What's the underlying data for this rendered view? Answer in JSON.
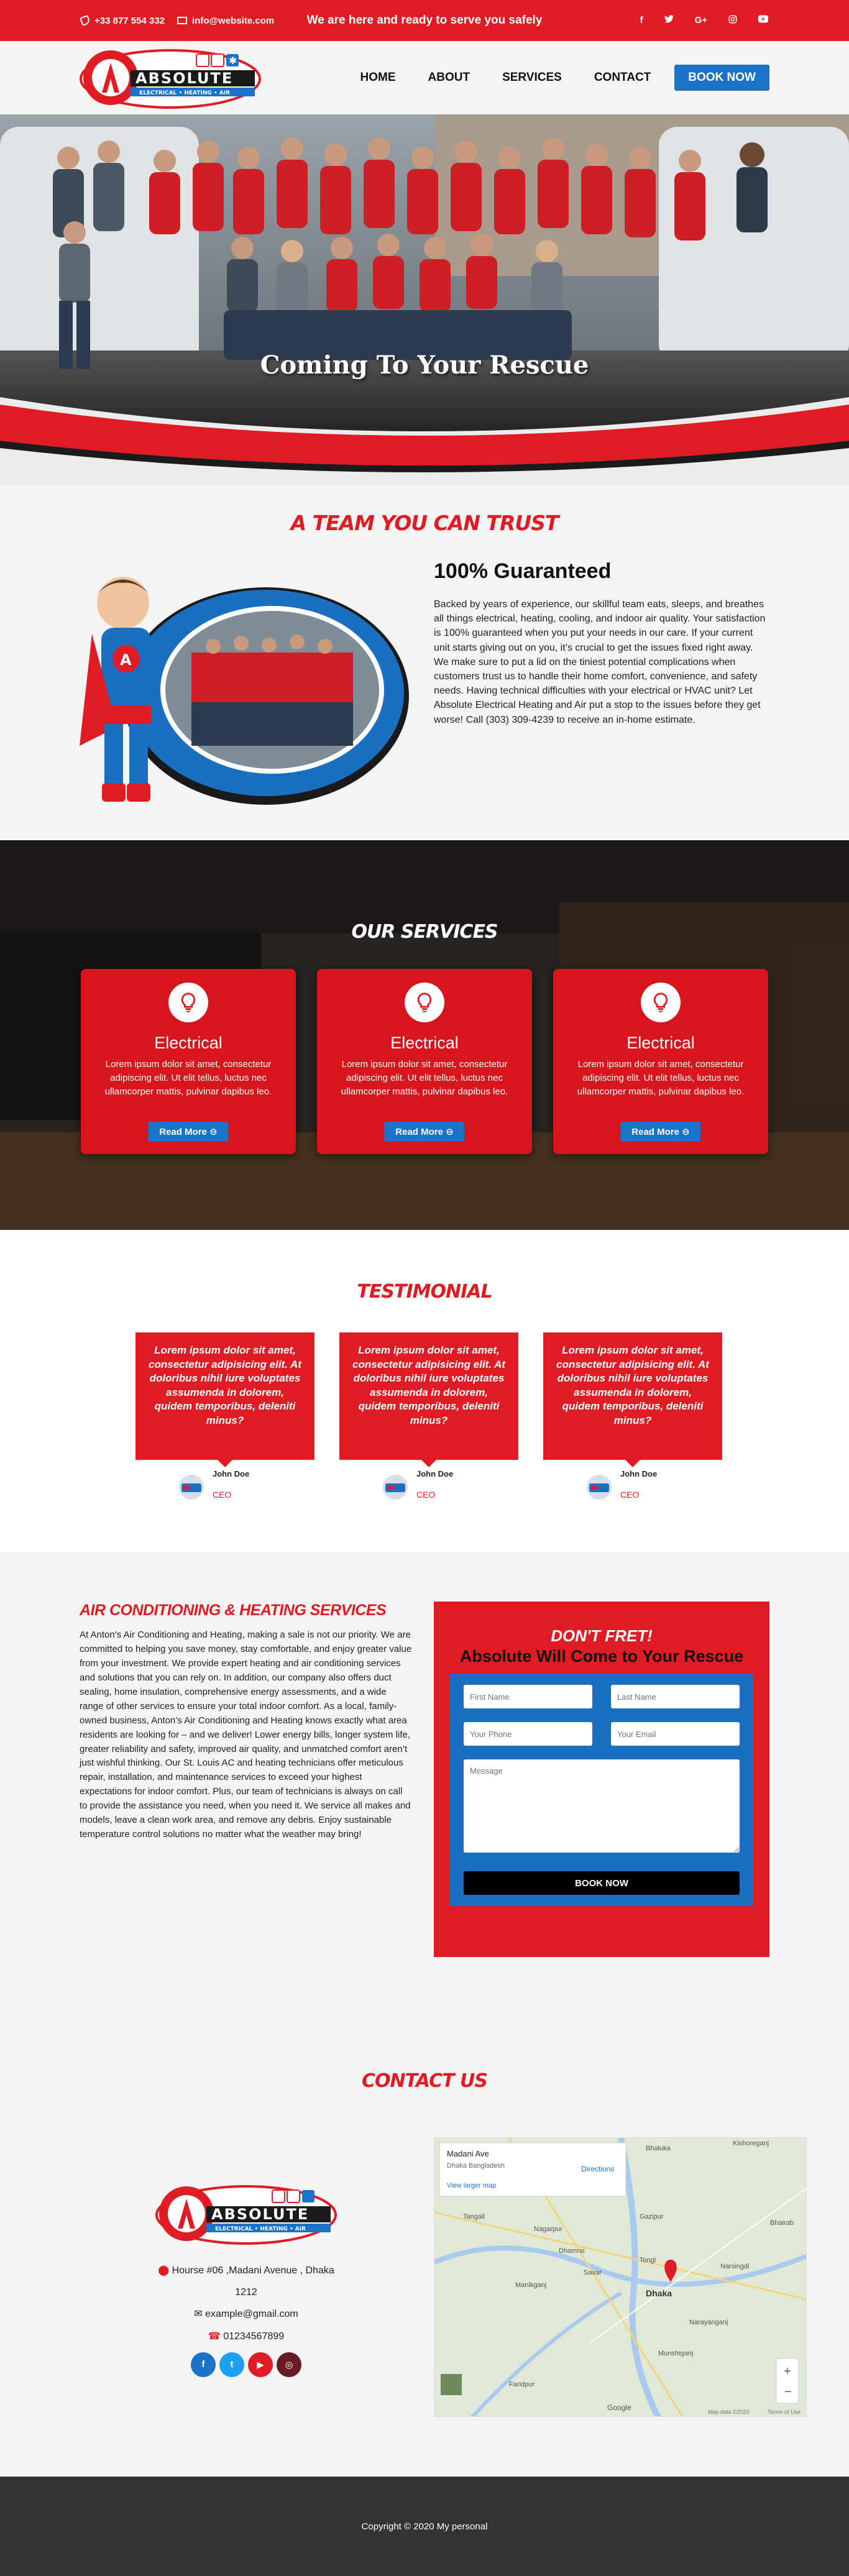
{
  "topbar": {
    "phone": "+33 877 554 332",
    "email": "info@website.com",
    "tagline": "We are here and ready to serve you safely",
    "socials": [
      "f",
      "t",
      "G+",
      "ig",
      "yt"
    ]
  },
  "header": {
    "logo_text": "ABSOLUTE",
    "logo_sub": "ELECTRICAL • HEATING • AIR",
    "nav": [
      "HOME",
      "ABOUT",
      "SERVICES",
      "CONTACT"
    ],
    "book_label": "BOOK NOW"
  },
  "hero": {
    "title": "Coming To Your Rescue"
  },
  "trust": {
    "section_title": "A TEAM YOU CAN TRUST",
    "heading": "100% Guaranteed",
    "body": "Backed by years of experience, our skillful team eats, sleeps, and breathes all things electrical, heating, cooling, and indoor air quality. Your satisfaction is 100% guaranteed when you put your needs in our care. If your current unit starts giving out on you, it’s crucial to get the issues fixed right away. We make sure to put a lid on the tiniest potential complications when customers trust us to handle their home comfort, convenience, and safety needs. Having technical difficulties with your electrical or HVAC unit? Let Absolute Electrical Heating and Air put a stop to the issues before they get worse! Call (303) 309-4239 to receive an in-home estimate."
  },
  "services": {
    "section_title": "OUR SERVICES",
    "cards": [
      {
        "title": "Electrical",
        "body": "Lorem ipsum dolor sit amet, consectetur adipiscing elit. Ut elit tellus, luctus nec ullamcorper mattis, pulvinar dapibus leo.",
        "button": "Read More"
      },
      {
        "title": "Electrical",
        "body": "Lorem ipsum dolor sit amet, consectetur adipiscing elit. Ut elit tellus, luctus nec ullamcorper mattis, pulvinar dapibus leo.",
        "button": "Read More"
      },
      {
        "title": "Electrical",
        "body": "Lorem ipsum dolor sit amet, consectetur adipiscing elit. Ut elit tellus, luctus nec ullamcorper mattis, pulvinar dapibus leo.",
        "button": "Read More"
      }
    ]
  },
  "testimonial": {
    "section_title": "TESTIMONIAL",
    "items": [
      {
        "quote": "Lorem ipsum dolor sit amet, consectetur adipisicing elit. At doloribus nihil iure voluptates assumenda in dolorem, quidem temporibus, deleniti minus?",
        "name": "John Doe",
        "role": "CEO"
      },
      {
        "quote": "Lorem ipsum dolor sit amet, consectetur adipisicing elit. At doloribus nihil iure voluptates assumenda in dolorem, quidem temporibus, deleniti minus?",
        "name": "John Doe",
        "role": "CEO"
      },
      {
        "quote": "Lorem ipsum dolor sit amet, consectetur adipisicing elit. At doloribus nihil iure voluptates assumenda in dolorem, quidem temporibus, deleniti minus?",
        "name": "John Doe",
        "role": "CEO"
      }
    ]
  },
  "ac": {
    "title": "AIR CONDITIONING & HEATING SERVICES",
    "body": "At Anton’s Air Conditioning and Heating, making a sale is not our priority. We are committed to helping you save money, stay comfortable, and enjoy greater value from your investment. We provide expert heating and air conditioning services and solutions that you can rely on. In addition, our company also offers duct sealing, home insulation, comprehensive energy assessments, and a wide range of other services to ensure your total indoor comfort. As a local, family-owned business, Anton’s Air Conditioning and Heating knows exactly what area residents are looking for – and we deliver! Lower energy bills, longer system life, greater reliability and safety, improved air quality, and unmatched comfort aren’t just wishful thinking. Our St. Louis AC and heating technicians offer meticulous repair, installation, and maintenance services to exceed your highest expectations for indoor comfort. Plus, our team of technicians is always on call to provide the assistance you need, when you need it. We service all makes and models, leave a clean work area, and remove any debris. Enjoy sustainable temperature control solutions no matter what the weather may bring!"
  },
  "form": {
    "kicker": "DON'T FRET!",
    "heading": "Absolute Will Come to Your Rescue",
    "first_name": "First Name",
    "last_name": "Last Name",
    "phone": "Your Phone",
    "email": "Your Email",
    "message": "Message",
    "submit": "BOOK NOW"
  },
  "contact": {
    "section_title": "CONTACT US",
    "address": "Hourse #06 ,Madani Avenue , Dhaka 1212",
    "email": "example@gmail.com",
    "phone": "01234567899",
    "map": {
      "place": "Madani Ave",
      "city": "Dhaka Bangladesh",
      "link": "View larger map",
      "directions": "Directions",
      "labels": [
        "Bhaluka",
        "Kishoreganj",
        "Tangail",
        "Gazipur",
        "Dhaka",
        "Narsingdi",
        "Narayanganj",
        "Munshiganj",
        "Manikganj",
        "Savar",
        "Tongi",
        "Nagarpur",
        "Dhamrai",
        "Faridpur",
        "Bhairab"
      ],
      "google": "Google",
      "attrib": "Map data ©2020",
      "terms": "Terms of Use"
    }
  },
  "footer": {
    "copyright": "Copyright © 2020 My personal"
  },
  "colors": {
    "brand_red": "#e01b24",
    "brand_blue": "#1a73c8",
    "footer_bg": "#333333"
  }
}
